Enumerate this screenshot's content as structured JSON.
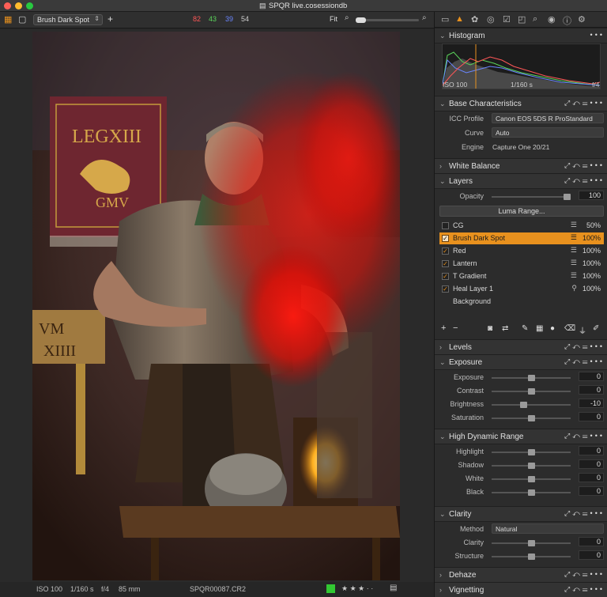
{
  "window": {
    "title": "SPQR live.cosessiondb"
  },
  "toolbar": {
    "layer_select": "Brush Dark Spot",
    "rgb": {
      "r": "82",
      "g": "43",
      "b": "39",
      "l": "54"
    },
    "zoom_label": "Fit"
  },
  "statusbar": {
    "iso": "ISO 100",
    "shutter": "1/160 s",
    "aperture": "f/4",
    "focal": "85 mm",
    "filename": "SPQR00087.CR2",
    "stars": "★ ★ ★ · ·"
  },
  "colors": {
    "accent": "#e8911e",
    "r": "#ff5757",
    "g": "#5bd45b",
    "b": "#6a86ff"
  },
  "sidebar": {
    "histogram": {
      "title": "Histogram",
      "iso": "ISO 100",
      "shutter": "1/160 s",
      "aperture": "f/4"
    },
    "base": {
      "title": "Base Characteristics",
      "icc_label": "ICC Profile",
      "icc_value": "Canon EOS 5DS R ProStandard",
      "curve_label": "Curve",
      "curve_value": "Auto",
      "engine_label": "Engine",
      "engine_value": "Capture One 20/21"
    },
    "white_balance": {
      "title": "White Balance"
    },
    "layers": {
      "title": "Layers",
      "opacity_label": "Opacity",
      "opacity_value": "100",
      "opacity_level": 1.0,
      "luma_button": "Luma Range...",
      "items": [
        {
          "name": "CG",
          "pct": "50%",
          "checked": false
        },
        {
          "name": "Brush Dark Spot",
          "pct": "100%",
          "checked": true
        },
        {
          "name": "Red",
          "pct": "100%",
          "checked": true
        },
        {
          "name": "Lantern",
          "pct": "100%",
          "checked": true
        },
        {
          "name": "T Gradient",
          "pct": "100%",
          "checked": true
        },
        {
          "name": "Heal Layer 1",
          "pct": "100%",
          "checked": true
        },
        {
          "name": "Background",
          "pct": "",
          "checked": false
        }
      ]
    },
    "levels": {
      "title": "Levels"
    },
    "exposure": {
      "title": "Exposure",
      "sliders": [
        {
          "label": "Exposure",
          "value": "0",
          "level": 0.5
        },
        {
          "label": "Contrast",
          "value": "0",
          "level": 0.5
        },
        {
          "label": "Brightness",
          "value": "-10",
          "level": 0.4
        },
        {
          "label": "Saturation",
          "value": "0",
          "level": 0.5
        }
      ]
    },
    "hdr": {
      "title": "High Dynamic Range",
      "sliders": [
        {
          "label": "Highlight",
          "value": "0",
          "level": 0.5
        },
        {
          "label": "Shadow",
          "value": "0",
          "level": 0.5
        },
        {
          "label": "White",
          "value": "0",
          "level": 0.5
        },
        {
          "label": "Black",
          "value": "0",
          "level": 0.5
        }
      ]
    },
    "clarity": {
      "title": "Clarity",
      "method_label": "Method",
      "method_value": "Natural",
      "sliders": [
        {
          "label": "Clarity",
          "value": "0",
          "level": 0.5
        },
        {
          "label": "Structure",
          "value": "0",
          "level": 0.5
        }
      ]
    },
    "dehaze": {
      "title": "Dehaze"
    },
    "vignetting": {
      "title": "Vignetting"
    }
  }
}
